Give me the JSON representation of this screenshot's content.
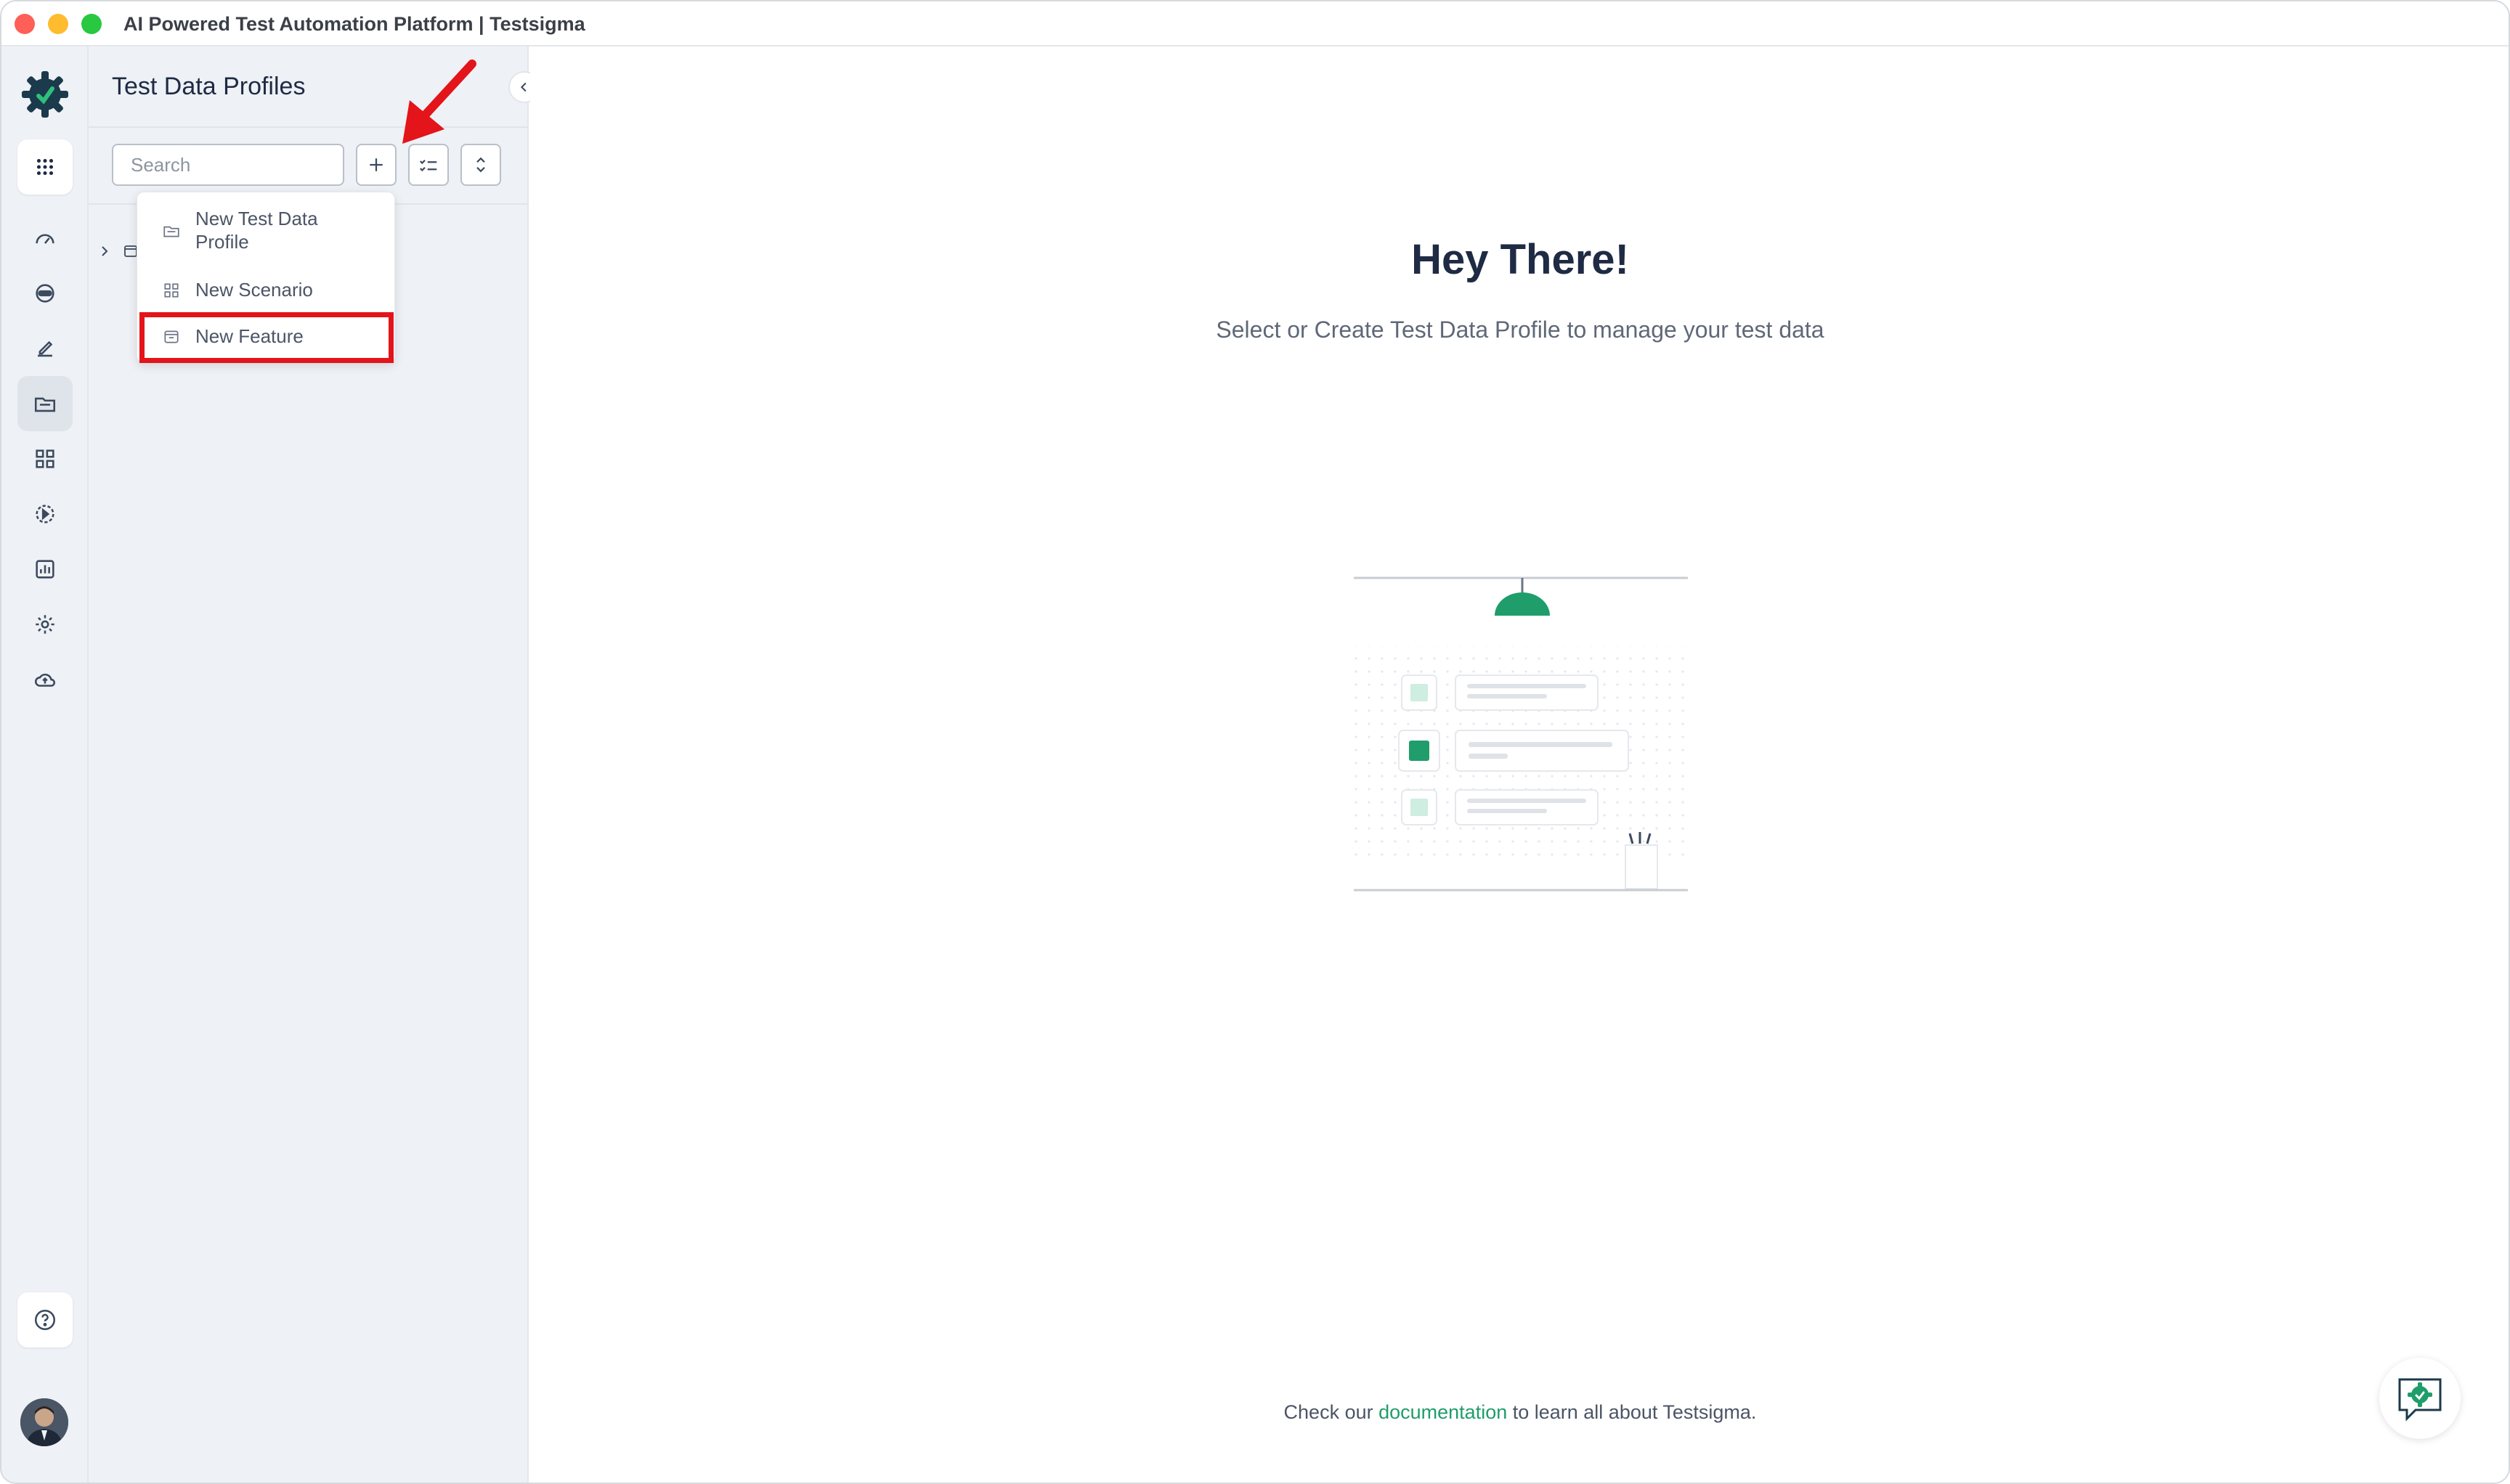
{
  "window": {
    "title": "AI Powered Test Automation Platform | Testsigma"
  },
  "sidebar": {
    "title": "Test Data Profiles",
    "search_placeholder": "Search"
  },
  "add_menu": {
    "items": [
      {
        "label": "New Test Data Profile",
        "icon": "folder-icon"
      },
      {
        "label": "New Scenario",
        "icon": "grid-icon"
      },
      {
        "label": "New Feature",
        "icon": "feature-icon"
      }
    ]
  },
  "main": {
    "heading": "Hey There!",
    "subheading": "Select or Create Test Data Profile to manage your test data",
    "footer_prefix": "Check our ",
    "footer_link": "documentation",
    "footer_suffix": " to learn all about Testsigma."
  },
  "colors": {
    "accent": "#1f9d6b",
    "highlight": "#e3141a",
    "brand": "#1b3a4b"
  }
}
